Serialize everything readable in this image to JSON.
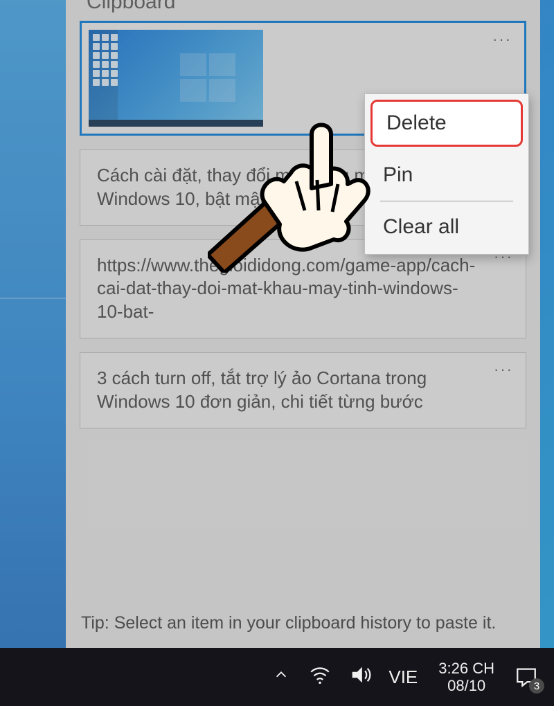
{
  "panel_title": "Clipboard",
  "items": [
    {
      "type": "image",
      "more": "···"
    },
    {
      "type": "text",
      "text": "Cách cài đặt, thay đổi mật khẩu máy tính Windows 10, bật mật khẩu Win10",
      "more": "···"
    },
    {
      "type": "text",
      "text": "https://www.thegioididong.com/game-app/cach-cai-dat-thay-doi-mat-khau-may-tinh-windows-10-bat-",
      "more": "···"
    },
    {
      "type": "text",
      "text": "3 cách turn off, tắt trợ lý ảo Cortana trong Windows 10 đơn giản, chi tiết từng bước",
      "more": "···"
    }
  ],
  "context_menu": {
    "delete": "Delete",
    "pin": "Pin",
    "clear_all": "Clear all"
  },
  "tip": "Tip: Select an item in your clipboard history to paste it.",
  "tray": {
    "lang": "VIE",
    "time": "3:26 CH",
    "date": "08/10",
    "badge": "3"
  }
}
